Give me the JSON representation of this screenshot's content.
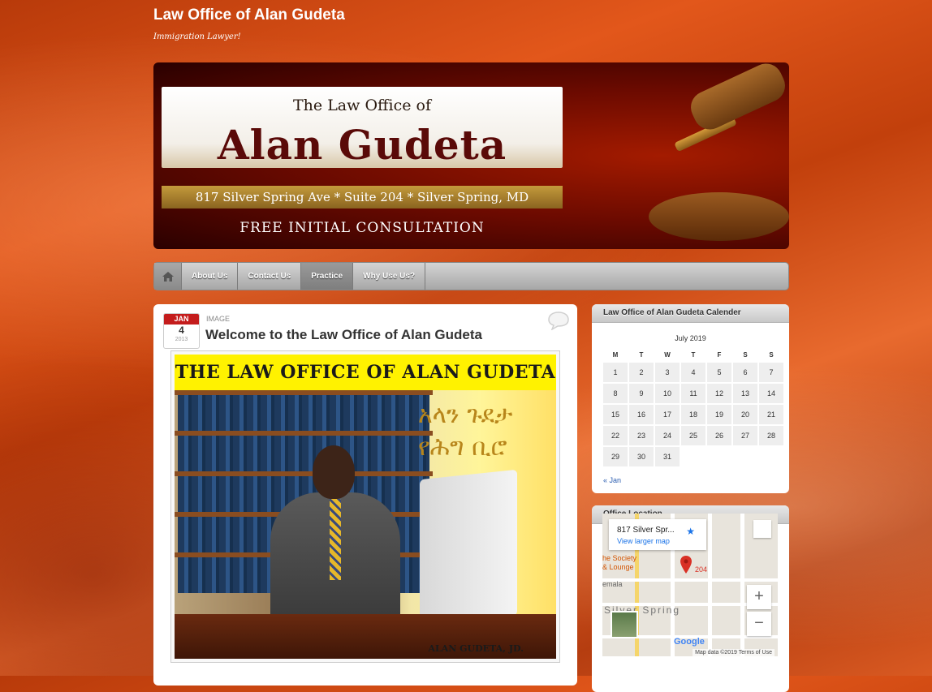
{
  "site": {
    "title": "Law Office of Alan Gudeta",
    "tagline": "Immigration Lawyer!"
  },
  "banner": {
    "line1": "The Law Office  of",
    "name": "Alan Gudeta",
    "address": "817 Silver Spring  Ave * Suite 204 * Silver Spring, MD",
    "consult": "FREE INITIAL CONSULTATION"
  },
  "nav": {
    "home_icon": "home-icon",
    "items": [
      "About Us",
      "Contact Us",
      "Practice",
      "Why Use Us?"
    ]
  },
  "post": {
    "date": {
      "month": "JAN",
      "day": "4",
      "year": "2013"
    },
    "type": "IMAGE",
    "title": "Welcome to the Law Office of Alan Gudeta",
    "image_title": "THE LAW OFFICE OF ALAN GUDETA",
    "image_amharic_1": "አላን ጉደታ",
    "image_amharic_2": "የሕግ ቢሮ",
    "image_caption": "ALAN GUDETA, JD."
  },
  "calendar": {
    "title": "Law Office of Alan Gudeta Calender",
    "caption": "July 2019",
    "days": [
      "M",
      "T",
      "W",
      "T",
      "F",
      "S",
      "S"
    ],
    "weeks": [
      [
        "1",
        "2",
        "3",
        "4",
        "5",
        "6",
        "7"
      ],
      [
        "8",
        "9",
        "10",
        "11",
        "12",
        "13",
        "14"
      ],
      [
        "15",
        "16",
        "17",
        "18",
        "19",
        "20",
        "21"
      ],
      [
        "22",
        "23",
        "24",
        "25",
        "26",
        "27",
        "28"
      ],
      [
        "29",
        "30",
        "31",
        "",
        "",
        "",
        ""
      ]
    ],
    "prev_link": "« Jan"
  },
  "location": {
    "title": "Office Location",
    "card_title": "817 Silver Spr...",
    "card_link": "View larger map",
    "pin_label": "204",
    "label_society": "he Society",
    "label_lounge": "& Lounge",
    "label_emala": "emala",
    "label_silver_spring": "Silver Spring",
    "zoom_in": "+",
    "zoom_out": "−",
    "google": "Google",
    "map_footer": "Map data ©2019   Terms of Use"
  }
}
